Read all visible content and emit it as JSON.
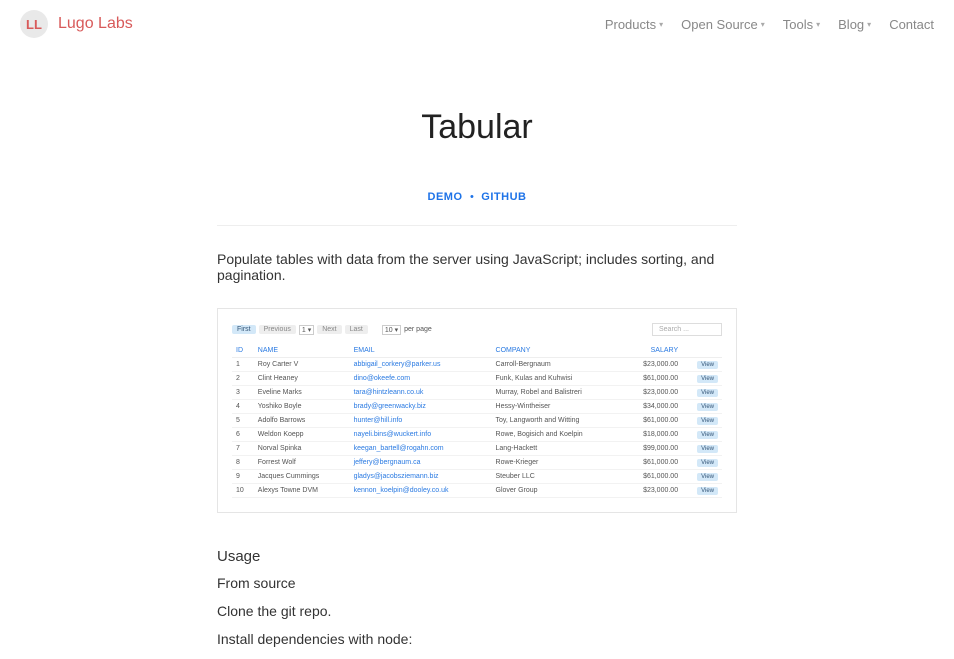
{
  "header": {
    "logo_letters": "LL",
    "brand": "Lugo Labs",
    "nav": {
      "products": "Products",
      "open_source": "Open Source",
      "tools": "Tools",
      "blog": "Blog",
      "contact": "Contact"
    }
  },
  "page": {
    "title": "Tabular",
    "demo_link": "DEMO",
    "github_link": "GITHUB",
    "description": "Populate tables with data from the server using JavaScript; includes sorting, and pagination."
  },
  "screenshot": {
    "controls": {
      "first": "First",
      "previous": "Previous",
      "page_val": "1",
      "next": "Next",
      "last": "Last",
      "per_page_val": "10",
      "per_page_label": "per page",
      "search_placeholder": "Search ..."
    },
    "headers": {
      "id": "ID",
      "name": "NAME",
      "email": "EMAIL",
      "company": "COMPANY",
      "salary": "SALARY"
    },
    "rows": [
      {
        "id": "1",
        "name": "Roy Carter V",
        "email": "abbigail_corkery@parker.us",
        "company": "Carroll-Bergnaum",
        "salary": "$23,000.00"
      },
      {
        "id": "2",
        "name": "Clint Heaney",
        "email": "dino@okeefe.com",
        "company": "Funk, Kulas and Kuhwisi",
        "salary": "$61,000.00"
      },
      {
        "id": "3",
        "name": "Eveline Marks",
        "email": "tara@hintzleann.co.uk",
        "company": "Murray, Robel and Balistreri",
        "salary": "$23,000.00"
      },
      {
        "id": "4",
        "name": "Yoshiko Boyle",
        "email": "brady@greenwacky.biz",
        "company": "Hessy-Wintheiser",
        "salary": "$34,000.00"
      },
      {
        "id": "5",
        "name": "Adolfo Barrows",
        "email": "hunter@hill.info",
        "company": "Toy, Langworth and Witting",
        "salary": "$61,000.00"
      },
      {
        "id": "6",
        "name": "Weldon Koepp",
        "email": "nayeli.bins@wuckert.info",
        "company": "Rowe, Bogisich and Koelpin",
        "salary": "$18,000.00"
      },
      {
        "id": "7",
        "name": "Norval Spinka",
        "email": "keegan_bartell@rogahn.com",
        "company": "Lang-Hackett",
        "salary": "$99,000.00"
      },
      {
        "id": "8",
        "name": "Forrest Wolf",
        "email": "jeffery@bergnaum.ca",
        "company": "Rowe-Krieger",
        "salary": "$61,000.00"
      },
      {
        "id": "9",
        "name": "Jacques Cummings",
        "email": "gladys@jacobsziemann.biz",
        "company": "Steuber LLC",
        "salary": "$61,000.00"
      },
      {
        "id": "10",
        "name": "Alexys Towne DVM",
        "email": "kennon_koelpin@dooley.co.uk",
        "company": "Glover Group",
        "salary": "$23,000.00"
      }
    ],
    "view_label": "View"
  },
  "sections": {
    "usage": "Usage",
    "from_source": "From source",
    "clone_repo": "Clone the git repo.",
    "install_deps": "Install dependencies with node:"
  }
}
